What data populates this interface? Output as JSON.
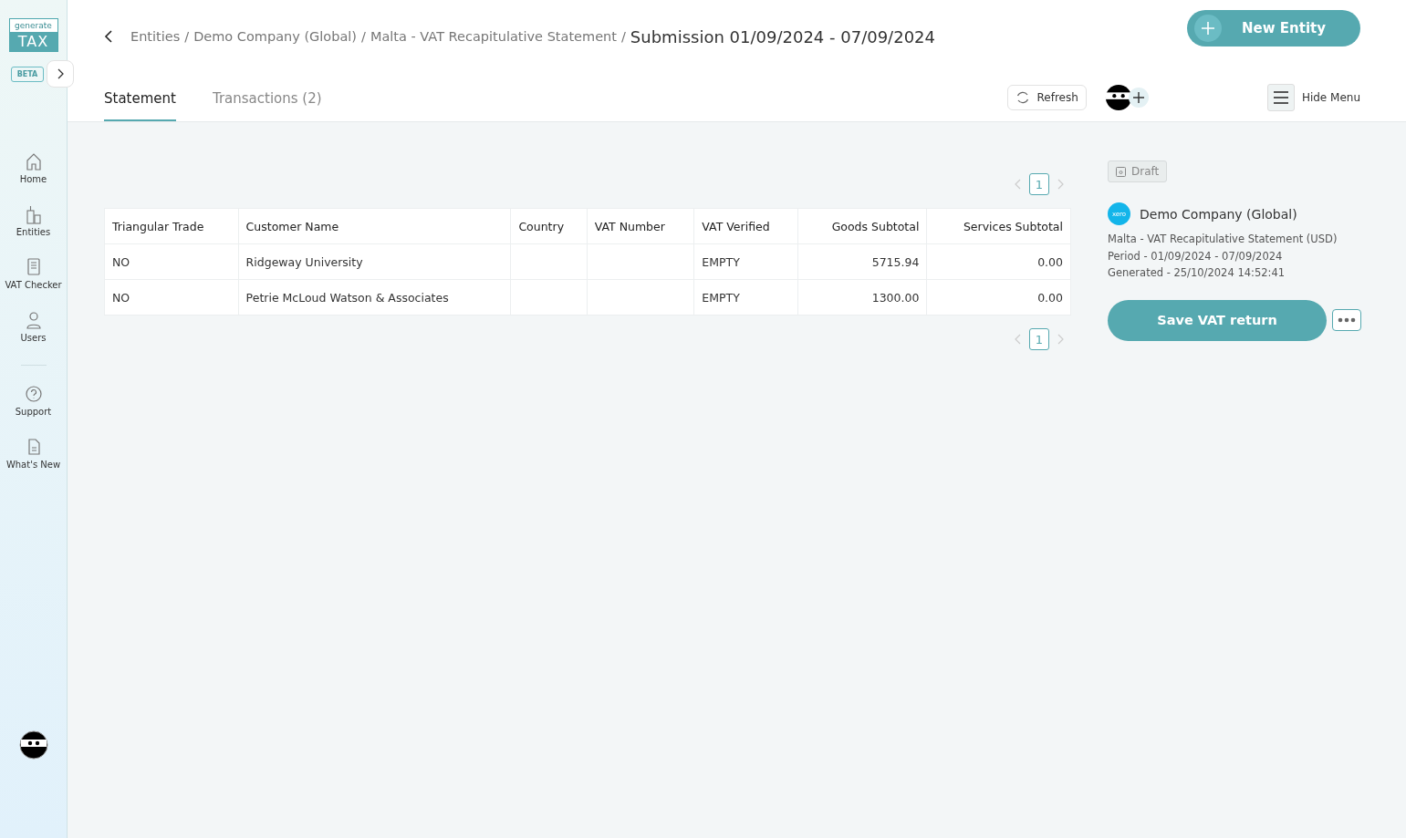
{
  "logo": {
    "top": "generate",
    "bottom": "TAX",
    "badge": "BETA"
  },
  "sidebar": {
    "items": [
      {
        "label": "Home"
      },
      {
        "label": "Entities"
      },
      {
        "label": "VAT Checker"
      },
      {
        "label": "Users"
      }
    ],
    "bottom_items": [
      {
        "label": "Support"
      },
      {
        "label": "What's New"
      }
    ]
  },
  "breadcrumb": {
    "separator": "/",
    "items": [
      "Entities",
      "Demo Company (Global)",
      "Malta - VAT Recapitulative Statement"
    ]
  },
  "page_title": "Submission 01/09/2024 - 07/09/2024",
  "new_entity_button": "New Entity",
  "tabs": [
    {
      "label": "Statement",
      "selected": true
    },
    {
      "label": "Transactions (2)",
      "selected": false
    }
  ],
  "refresh_button": "Refresh",
  "hide_menu_button": "Hide Menu",
  "pagination_top": [
    {
      "label": "1",
      "selected": true
    }
  ],
  "table": {
    "columns": [
      {
        "label": "Triangular Trade",
        "kind": "text"
      },
      {
        "label": "Customer Name",
        "kind": "text"
      },
      {
        "label": "Country",
        "kind": "text"
      },
      {
        "label": "VAT Number",
        "kind": "text"
      },
      {
        "label": "VAT Verified",
        "kind": "text"
      },
      {
        "label": "Goods Subtotal",
        "kind": "amount"
      },
      {
        "label": "Services Subtotal",
        "kind": "amount"
      }
    ],
    "rows": [
      [
        "NO",
        "Ridgeway University",
        "",
        "",
        "EMPTY",
        "5715.94",
        "0.00"
      ],
      [
        "NO",
        "Petrie McLoud Watson & Associates",
        "",
        "",
        "EMPTY",
        "1300.00",
        "0.00"
      ]
    ]
  },
  "pagination_bottom": [
    {
      "label": "1",
      "selected": true
    }
  ],
  "status_badge": "Draft",
  "summary": {
    "logo_text": "xero",
    "company": "Demo Company (Global)",
    "lines": [
      "Malta - VAT Recapitulative Statement (USD)",
      "Period - 01/09/2024 - 07/09/2024",
      "Generated - 25/10/2024 14:52:41"
    ]
  },
  "save_button": "Save VAT return"
}
